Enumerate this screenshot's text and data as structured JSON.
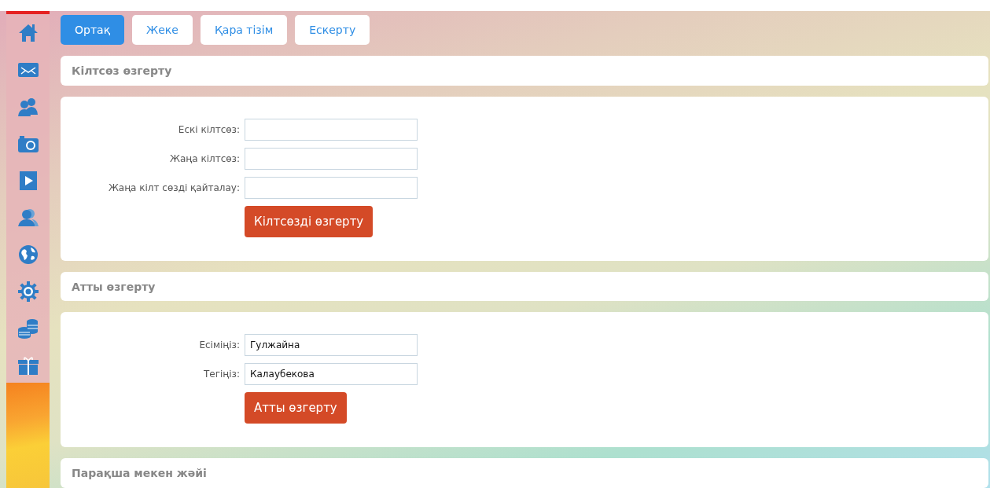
{
  "sidebar": {
    "items": [
      {
        "kind": "home"
      },
      {
        "kind": "mail"
      },
      {
        "kind": "users"
      },
      {
        "kind": "camera"
      },
      {
        "kind": "play"
      },
      {
        "kind": "people"
      },
      {
        "kind": "globe"
      },
      {
        "kind": "gear"
      },
      {
        "kind": "coins"
      },
      {
        "kind": "gift"
      }
    ]
  },
  "tabs": [
    {
      "label": "Ортақ",
      "selected": true
    },
    {
      "label": "Жеке",
      "selected": false
    },
    {
      "label": "Қара тізім",
      "selected": false
    },
    {
      "label": "Ескерту",
      "selected": false
    }
  ],
  "sections": [
    {
      "title": "Кілтсөз өзгерту",
      "fields": [
        {
          "label": "Ескі кілтсөз:"
        },
        {
          "label": "Жаңа кілтсөз:"
        },
        {
          "label": "Жаңа кілт сөзді қайталау:"
        }
      ],
      "button": "Кілтсөзді өзгерту"
    },
    {
      "title": "Атты өзгерту",
      "fields": [
        {
          "label": "Есіміңіз:",
          "value": "Гулжайна"
        },
        {
          "label": "Тегіңіз:",
          "value": "Калаубекова"
        }
      ],
      "button": "Атты өзгерту"
    },
    {
      "title": "Парақша мекен жәйі"
    }
  ]
}
